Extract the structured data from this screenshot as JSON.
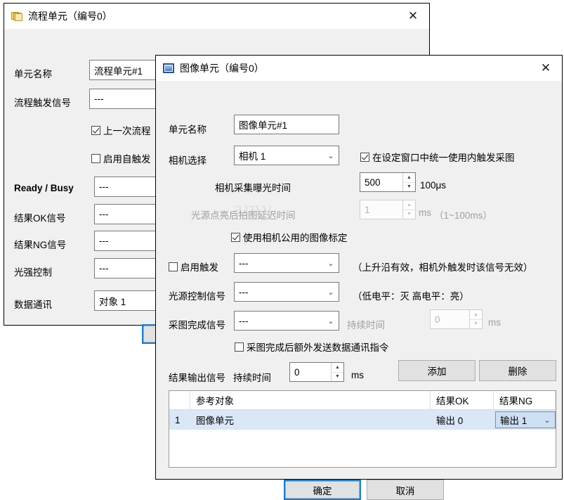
{
  "flow_dialog": {
    "title": "流程单元（编号0）",
    "icon": "folder-stack-icon",
    "close_label": "✕",
    "fields": {
      "unit_name_label": "单元名称",
      "unit_name_value": "流程单元#1",
      "trigger_label": "流程触发信号",
      "trigger_value": "---",
      "checkbox_prev_flow": "上一次流程",
      "checkbox_auto_trigger": "启用自触发",
      "ready_busy_label": "Ready / Busy",
      "ready_busy_value": "---",
      "result_ok_label": "结果OK信号",
      "result_ok_value": "---",
      "result_ng_label": "结果NG信号",
      "result_ng_value": "---",
      "light_label": "光强控制",
      "light_value": "---",
      "data_comm_label": "数据通讯",
      "data_comm_value": "对象 1"
    }
  },
  "image_dialog": {
    "title": "图像单元（编号0）",
    "icon": "image-unit-icon",
    "close_label": "✕",
    "watermark": "amv",
    "unit_name_label": "单元名称",
    "unit_name_value": "图像单元#1",
    "camera_label": "相机选择",
    "camera_value": "相机 1",
    "unified_internal_trigger_label": "在设定窗口中统一使用内触发采图",
    "unified_internal_trigger_checked": true,
    "exposure_label": "相机采集曝光时间",
    "exposure_value": "500",
    "exposure_unit": "100μs",
    "delay_label": "光源点亮后拍图延迟时间",
    "delay_value": "1",
    "delay_unit": "ms",
    "delay_range": "（1~100ms）",
    "use_common_calib_label": "使用相机公用的图像标定",
    "use_common_calib_checked": true,
    "enable_trigger_label": "启用触发",
    "enable_trigger_checked": false,
    "enable_trigger_value": "---",
    "enable_trigger_note": "（上升沿有效，相机外触发时该信号无效）",
    "light_signal_label": "光源控制信号",
    "light_signal_value": "---",
    "light_signal_note": "（低电平：灭    高电平：亮）",
    "capture_done_label": "采图完成信号",
    "capture_done_value": "---",
    "duration_label_1": "持续时间",
    "duration_value_1": "0",
    "duration_unit_1": "ms",
    "extra_send_label": "采图完成后额外发送数据通讯指令",
    "extra_send_checked": false,
    "result_output_label": "结果输出信号",
    "duration_label_2": "持续时间",
    "duration_value_2": "0",
    "duration_unit_2": "ms",
    "add_button": "添加",
    "delete_button": "删除",
    "table": {
      "columns": [
        "",
        "参考对象",
        "结果OK",
        "结果NG"
      ],
      "rows": [
        {
          "index": "1",
          "ref": "图像单元",
          "ok": "输出 0",
          "ng": "输出 1"
        }
      ]
    },
    "ok_button": "确定",
    "cancel_button": "取消"
  },
  "colors": {
    "accent": "#1a7fd4",
    "row_selected": "#d9e7f7",
    "window_bg": "#f0f0f0"
  }
}
